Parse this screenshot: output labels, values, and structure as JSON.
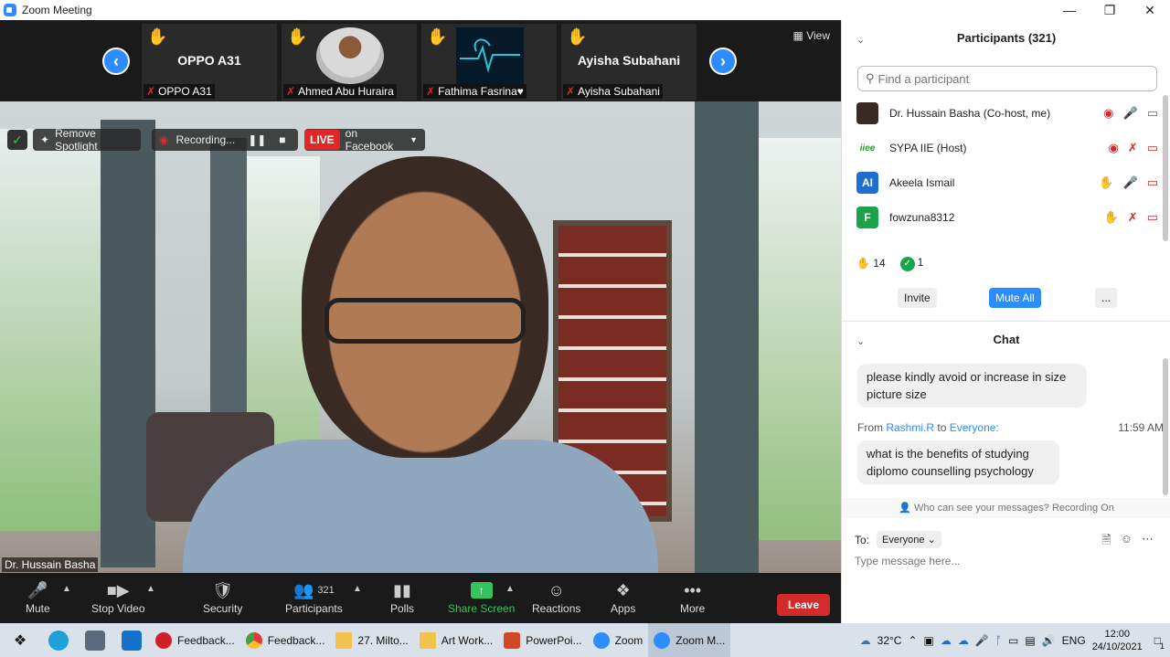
{
  "window": {
    "title": "Zoom Meeting",
    "controls": [
      "—",
      "❐",
      "✕"
    ]
  },
  "strip": {
    "view_label": "View",
    "tiles": [
      {
        "big": "OPPO A31",
        "label": "OPPO A31"
      },
      {
        "big": "",
        "label": "Ahmed Abu Huraira"
      },
      {
        "big": "",
        "label": "Fathima Fasrina♥"
      },
      {
        "big": "Ayisha Subahani",
        "label": "Ayisha Subahani"
      }
    ]
  },
  "video": {
    "remove_spotlight": "Remove Spotlight",
    "recording": "Recording...",
    "live": "LIVE",
    "live_target": "on Facebook",
    "speaker": "Dr. Hussain Basha"
  },
  "toolbar": {
    "mute": "Mute",
    "stop_video": "Stop Video",
    "security": "Security",
    "participants": "Participants",
    "participants_count": "321",
    "polls": "Polls",
    "share_screen": "Share Screen",
    "reactions": "Reactions",
    "apps": "Apps",
    "more": "More",
    "leave": "Leave"
  },
  "participants_panel": {
    "title": "Participants (321)",
    "search_placeholder": "Find a participant",
    "list": [
      {
        "initials": "",
        "name": "Dr. Hussain Basha (Co-host, me)",
        "color": "#3a2a24"
      },
      {
        "initials": "",
        "name": "SYPA IIE (Host)",
        "color": "#ffffff"
      },
      {
        "initials": "AI",
        "name": "Akeela Ismail",
        "color": "#1f6fd0"
      },
      {
        "initials": "F",
        "name": "fowzuna8312",
        "color": "#1aa34a"
      }
    ],
    "hands_count": "14",
    "yes_count": "1",
    "invite": "Invite",
    "mute_all": "Mute All",
    "more": "..."
  },
  "chat": {
    "title": "Chat",
    "message1": "please kindly avoid or increase in size picture size",
    "from_prefix": "From",
    "from_name": "Rashmi.R",
    "to_word": "to",
    "to_name": "Everyone:",
    "time": "11:59 AM",
    "message2": "what is the benefits of studying diplomo counselling psychology",
    "who_can_see": "Who can see your messages? Recording On",
    "to_label": "To:",
    "to_select": "Everyone",
    "input_placeholder": "Type message here..."
  },
  "taskbar": {
    "tasks": [
      "Feedback...",
      "Feedback...",
      "27. Milto...",
      "Art Work...",
      "PowerPoi...",
      "Zoom",
      "Zoom M..."
    ],
    "temperature": "32°C",
    "lang": "ENG",
    "time": "12:00",
    "date": "24/10/2021",
    "notifications": "1"
  },
  "colors": {
    "accent": "#2D8CFF",
    "danger": "#d32a2a",
    "share_green": "#35c35e"
  }
}
